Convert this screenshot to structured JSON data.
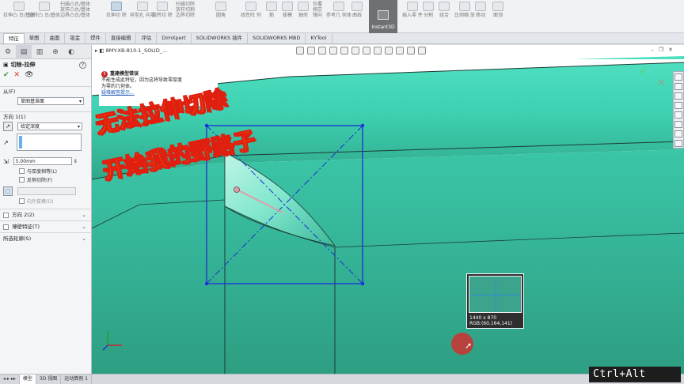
{
  "ribbon": {
    "groups": [
      {
        "label": "拉伸凸\n台/基体"
      },
      {
        "label": "旋转凸\n台/基体"
      },
      {
        "label": "扫描凸台/基体\n放样凸台/基体\n边界凸台/基体"
      },
      {
        "label": "拉伸切\n除"
      },
      {
        "label": "异型孔\n向导"
      },
      {
        "label": "旋转切\n除"
      },
      {
        "label": "扫描切除\n放样切割\n边界切除"
      },
      {
        "label": "圆角"
      },
      {
        "label": "线性阵\n列"
      },
      {
        "label": "筋"
      },
      {
        "label": "拔模"
      },
      {
        "label": "抽壳"
      },
      {
        "label": "包覆\n相交\n镜向"
      },
      {
        "label": "参考几\n何体"
      },
      {
        "label": "曲线"
      },
      {
        "label": "插入零\n件"
      },
      {
        "label": "分割"
      },
      {
        "label": "组合"
      },
      {
        "label": "比例缩\n放"
      },
      {
        "label": "移动"
      },
      {
        "label": "面顶"
      }
    ],
    "instant3d": "Instant3D"
  },
  "tabs": [
    "特征",
    "草图",
    "曲面",
    "钣金",
    "焊件",
    "直接编辑",
    "评估",
    "DimXpert",
    "SOLIDWORKS 插件",
    "SOLIDWORKS MBD",
    "KYTool"
  ],
  "active_tab": "特征",
  "panel": {
    "title": "切除-拉伸",
    "from_label": "从(F)",
    "from_value": "草图基准面",
    "dir1_label": "方向 1(1)",
    "end_condition": "给定深度",
    "depth": "5.00mm",
    "cb_equal_thickness": "与厚度相等(L)",
    "cb_flip_side": "反侧切除(F)",
    "cb_draft_outward": "向外拔模(O)",
    "dir2_label": "方向 2(2)",
    "thin_feature": "薄壁特征(T)",
    "selected_contours": "所选轮廓(S)"
  },
  "viewport": {
    "doc_title": "8MY-XB-810-1_SOLID_...",
    "error_title": "重建模型错误",
    "error_body_1": "不能生成此特征，因为这将导致零厚度",
    "error_body_2": "为零的几何体。",
    "error_link": "疑难解答提示..."
  },
  "overlay": {
    "line1": "无法拉伸切除",
    "line2": "开始我的野路子"
  },
  "magnifier": {
    "size": "1440 x 870",
    "rgb": "RGB:(60,164,141)"
  },
  "status_tabs": [
    "模型",
    "3D 视图",
    "运动算例 1"
  ],
  "keys_overlay": "Ctrl+Alt",
  "colors": {
    "model_face": "#3ca48d",
    "sketch": "#1b2fd6",
    "overlay_text": "#f4e500",
    "overlay_stroke": "#e01f10"
  }
}
